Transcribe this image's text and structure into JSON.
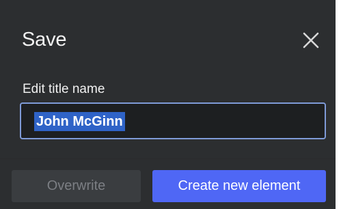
{
  "dialog": {
    "title": "Save",
    "close_icon": "close-icon"
  },
  "field": {
    "label": "Edit title name",
    "value": "John McGinn",
    "selected": true
  },
  "buttons": {
    "overwrite_label": "Overwrite",
    "overwrite_enabled": false,
    "create_label": "Create new element"
  },
  "colors": {
    "background": "#2c2e30",
    "input_border": "#7f9bd8",
    "selection": "#2f63c7",
    "primary_button": "#4f67f5",
    "disabled_button": "#3a3d40"
  }
}
